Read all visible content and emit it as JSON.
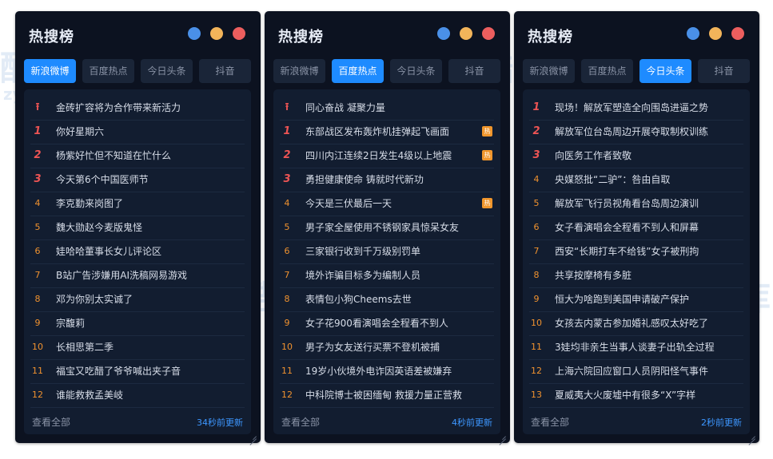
{
  "colors": {
    "accent": "#1e8bff",
    "panel_bg": "#0c1220",
    "list_bg": "#121d30",
    "hot_badge": "#f0962c",
    "rank_top": "#ec5454",
    "rank_normal": "#f0922f"
  },
  "icons": {
    "pin": "pin-up-arrow-icon",
    "dots": [
      "blue-dot",
      "yellow-dot",
      "red-dot"
    ]
  },
  "watermark": {
    "cn": "酷库",
    "en": "Blog",
    "domain": "zyku.cn"
  },
  "panels": [
    {
      "title": "热搜榜",
      "tabs": [
        "新浪微博",
        "百度热点",
        "今日头条",
        "抖音"
      ],
      "active_tab": 0,
      "items": [
        {
          "rank": "pin",
          "text": "金砖扩容将为合作带来新活力",
          "hot": ""
        },
        {
          "rank": "1",
          "text": "你好星期六",
          "hot": ""
        },
        {
          "rank": "2",
          "text": "杨紫好忙但不知道在忙什么",
          "hot": ""
        },
        {
          "rank": "3",
          "text": "今天第6个中国医师节",
          "hot": ""
        },
        {
          "rank": "4",
          "text": "李克勤来岗图了",
          "hot": ""
        },
        {
          "rank": "5",
          "text": "魏大勋赵今麦版鬼怪",
          "hot": ""
        },
        {
          "rank": "6",
          "text": "娃哈哈董事长女儿评论区",
          "hot": ""
        },
        {
          "rank": "7",
          "text": "B站广告涉嫌用AI洗稿网易游戏",
          "hot": ""
        },
        {
          "rank": "8",
          "text": "邓为你别太实诚了",
          "hot": ""
        },
        {
          "rank": "9",
          "text": "宗馥莉",
          "hot": ""
        },
        {
          "rank": "10",
          "text": "长相思第二季",
          "hot": ""
        },
        {
          "rank": "11",
          "text": "福宝又吃醋了爷爷喊出夹子音",
          "hot": ""
        },
        {
          "rank": "12",
          "text": "谁能救救孟美岐",
          "hot": ""
        }
      ],
      "footer_left": "查看全部",
      "footer_right": "34秒前更新"
    },
    {
      "title": "热搜榜",
      "tabs": [
        "新浪微博",
        "百度热点",
        "今日头条",
        "抖音"
      ],
      "active_tab": 1,
      "items": [
        {
          "rank": "pin",
          "text": "同心奋战 凝聚力量",
          "hot": ""
        },
        {
          "rank": "1",
          "text": "东部战区发布轰炸机挂弹起飞画面",
          "hot": "热"
        },
        {
          "rank": "2",
          "text": "四川内江连续2日发生4级以上地震",
          "hot": "热"
        },
        {
          "rank": "3",
          "text": "勇担健康使命 铸就时代新功",
          "hot": ""
        },
        {
          "rank": "4",
          "text": "今天是三伏最后一天",
          "hot": "热"
        },
        {
          "rank": "5",
          "text": "男子家全屋使用不锈钢家具惊呆女友",
          "hot": ""
        },
        {
          "rank": "6",
          "text": "三家银行收到千万级别罚单",
          "hot": ""
        },
        {
          "rank": "7",
          "text": "境外诈骗目标多为编制人员",
          "hot": ""
        },
        {
          "rank": "8",
          "text": "表情包小狗Cheems去世",
          "hot": ""
        },
        {
          "rank": "9",
          "text": "女子花900看演唱会全程看不到人",
          "hot": ""
        },
        {
          "rank": "10",
          "text": "男子为女友送行买票不登机被捕",
          "hot": ""
        },
        {
          "rank": "11",
          "text": "19岁小伙境外电诈因英语差被嫌弃",
          "hot": ""
        },
        {
          "rank": "12",
          "text": "中科院博士被困缅甸 救援力量正营救",
          "hot": ""
        }
      ],
      "footer_left": "查看全部",
      "footer_right": "4秒前更新"
    },
    {
      "title": "热搜榜",
      "tabs": [
        "新浪微博",
        "百度热点",
        "今日头条",
        "抖音"
      ],
      "active_tab": 2,
      "items": [
        {
          "rank": "1",
          "text": "现场！解放军塑造全向围岛进逼之势",
          "hot": ""
        },
        {
          "rank": "2",
          "text": "解放军位台岛周边开展夺取制权训练",
          "hot": ""
        },
        {
          "rank": "3",
          "text": "向医务工作者致敬",
          "hot": ""
        },
        {
          "rank": "4",
          "text": "央媒怒批“二驴”：咎由自取",
          "hot": ""
        },
        {
          "rank": "5",
          "text": "解放军飞行员视角看台岛周边演训",
          "hot": ""
        },
        {
          "rank": "6",
          "text": "女子看演唱会全程看不到人和屏幕",
          "hot": ""
        },
        {
          "rank": "7",
          "text": "西安“长期打车不给钱”女子被刑拘",
          "hot": ""
        },
        {
          "rank": "8",
          "text": "共享按摩椅有多脏",
          "hot": ""
        },
        {
          "rank": "9",
          "text": "恒大为啥跑到美国申请破产保护",
          "hot": ""
        },
        {
          "rank": "10",
          "text": "女孩去内蒙古参加婚礼感叹太好吃了",
          "hot": ""
        },
        {
          "rank": "11",
          "text": "3娃均非亲生当事人谈妻子出轨全过程",
          "hot": ""
        },
        {
          "rank": "12",
          "text": "上海六院回应窗口人员阴阳怪气事件",
          "hot": ""
        },
        {
          "rank": "13",
          "text": "夏威夷大火废墟中有很多“X”字样",
          "hot": ""
        }
      ],
      "footer_left": "查看全部",
      "footer_right": "2秒前更新"
    }
  ]
}
